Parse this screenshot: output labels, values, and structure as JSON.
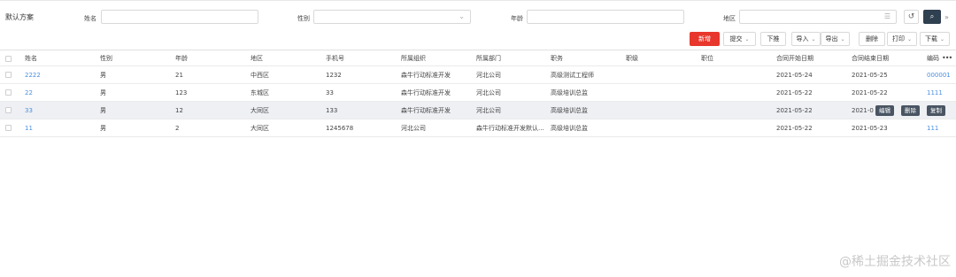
{
  "filter": {
    "scheme": "默认方案",
    "name_label": "姓名",
    "gender_label": "性别",
    "age_label": "年龄",
    "district_label": "地区"
  },
  "toolbar": {
    "new": "新增",
    "submit": "提交",
    "push_down": "下推",
    "import": "导入",
    "export": "导出",
    "delete": "删除",
    "print": "打印",
    "download": "下载"
  },
  "table": {
    "columns": [
      "姓名",
      "性别",
      "年龄",
      "地区",
      "手机号",
      "所属组织",
      "所属部门",
      "职务",
      "职级",
      "职位",
      "合同开始日期",
      "合同结束日期",
      "编码"
    ],
    "rows": [
      [
        "2222",
        "男",
        "21",
        "中西区",
        "1232",
        "森牛行动标准开发",
        "河北公司",
        "高级测试工程师",
        "",
        "",
        "2021-05-24",
        "2021-05-25",
        "000001"
      ],
      [
        "22",
        "男",
        "123",
        "东城区",
        "33",
        "森牛行动标准开发",
        "河北公司",
        "高级培训总监",
        "",
        "",
        "2021-05-22",
        "2021-05-22",
        "1111"
      ],
      [
        "33",
        "男",
        "12",
        "大同区",
        "133",
        "森牛行动标准开发",
        "河北公司",
        "高级培训总监",
        "",
        "",
        "2021-05-22",
        "2021-0",
        ""
      ],
      [
        "11",
        "男",
        "2",
        "大同区",
        "1245678",
        "河北公司",
        "森牛行动标准开发默认...",
        "高级培训总监",
        "",
        "",
        "2021-05-22",
        "2021-05-23",
        "111"
      ]
    ],
    "row_actions": {
      "edit": "编辑",
      "delete": "删除",
      "copy": "复制"
    }
  },
  "watermark": "@稀土掘金技术社区",
  "colors": {
    "primary_red": "#e8372c",
    "link_blue": "#4a8fe0",
    "dark_button": "#2f4050",
    "row_highlight": "#eef0f4"
  }
}
